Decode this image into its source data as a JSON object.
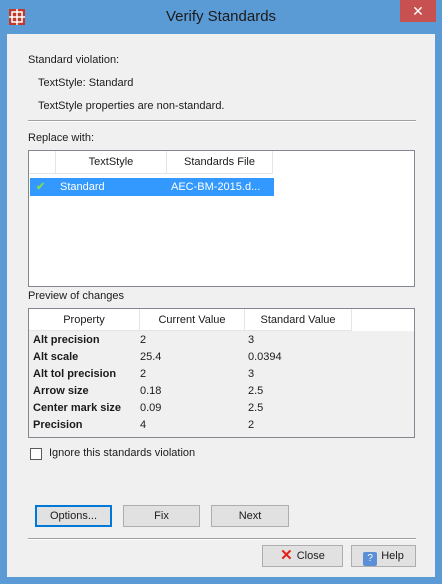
{
  "window": {
    "title": "Verify Standards",
    "close_glyph": "✕",
    "accent": "#5b9bd5"
  },
  "violation": {
    "heading": "Standard violation:",
    "object": "TextStyle:  Standard",
    "message": "TextStyle properties are non-standard."
  },
  "replace": {
    "label": "Replace with:",
    "columns": [
      "TextStyle",
      "Standards File"
    ],
    "rows": [
      {
        "check": "✔",
        "name": "Standard",
        "file": "AEC-BM-2015.d..."
      }
    ]
  },
  "preview": {
    "label": "Preview of changes",
    "columns": [
      "Property",
      "Current Value",
      "Standard Value"
    ],
    "rows": [
      {
        "property": "Alt precision",
        "current": "2",
        "standard": "3"
      },
      {
        "property": "Alt scale",
        "current": "25.4",
        "standard": "0.0394"
      },
      {
        "property": "Alt tol precision",
        "current": "2",
        "standard": "3"
      },
      {
        "property": "Arrow size",
        "current": "0.18",
        "standard": "2.5"
      },
      {
        "property": "Center mark size",
        "current": "0.09",
        "standard": "2.5"
      },
      {
        "property": "Precision",
        "current": "4",
        "standard": "2"
      }
    ]
  },
  "ignore_checkbox": {
    "label": "Ignore this standards violation",
    "checked": false
  },
  "buttons": {
    "options": "Options...",
    "fix": "Fix",
    "next": "Next",
    "close": "Close",
    "help": "Help",
    "close_icon": "✕",
    "help_icon": "?"
  }
}
